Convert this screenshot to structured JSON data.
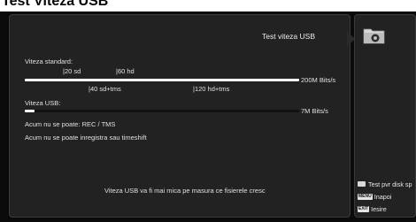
{
  "page_heading": "Test Viteza USB",
  "screen_title": "Test viteza USB",
  "standard": {
    "label": "Viteza standard:",
    "marks_top": [
      "|20 sd",
      "|60 hd"
    ],
    "marks_bottom": [
      "|40 sd+tms",
      "|120 hd+tms"
    ],
    "max_label": "200M Bits/s",
    "fill_fraction": 1.0
  },
  "usb": {
    "label": "Viteza USB:",
    "value_label": "7M Bits/s",
    "fill_fraction": 0.035
  },
  "status": {
    "line1": "Acum nu se poate: REC / TMS",
    "line2": "Acum nu se poate inregistra sau timeshift"
  },
  "footer_note": "Viteza USB va fi mai mica pe masura ce fisierele cresc",
  "side_menu": {
    "icon": "folder-settings-icon",
    "items": [
      {
        "key": "",
        "label": "Test pvr disk sp"
      },
      {
        "key": "MENU",
        "label": "Inapoi"
      },
      {
        "key": "EXIT",
        "label": "Iesire"
      }
    ]
  },
  "colors": {
    "background": "#0a0a0a",
    "panel": "#222222",
    "bar": "#ffffff",
    "text": "#e0e0e0"
  }
}
